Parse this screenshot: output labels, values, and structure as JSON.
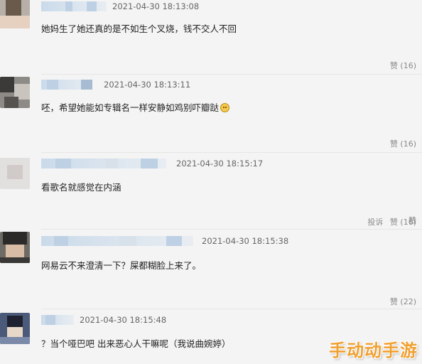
{
  "comments": [
    {
      "time": "2021-04-30 18:13:08",
      "content": "她妈生了她还真的是不如生个叉烧，钱不交人不回",
      "like_label": "赞",
      "like_count": "(16)"
    },
    {
      "time": "2021-04-30 18:13:11",
      "content": "呸，希望她能如专辑名一样安静如鸡别吓瓣跶",
      "like_label": "赞",
      "like_count": "(16)"
    },
    {
      "time": "2021-04-30 18:15:17",
      "content": "看歌名就感觉在内涵",
      "like_label": "赞",
      "like_count": ""
    },
    {
      "time": "2021-04-30 18:15:38",
      "content": "网易云不来澄清一下？屎都糊脸上来了。",
      "report_label": "投诉",
      "like_label": "赞",
      "like_count": "(16)"
    },
    {
      "time": "2021-04-30 18:15:48",
      "content": "？当个哑巴吧 出来恶心人干嘛呢（我说曲婉婷）",
      "like_label": "赞",
      "like_count": "(22)"
    }
  ],
  "icons": [
    "emoji-icon"
  ],
  "watermark": "手动动手游",
  "colors": {
    "background": "#f4f4f4",
    "username_blur": "#c6d8ea",
    "meta_text": "#666666",
    "watermark": "#f0a030"
  }
}
